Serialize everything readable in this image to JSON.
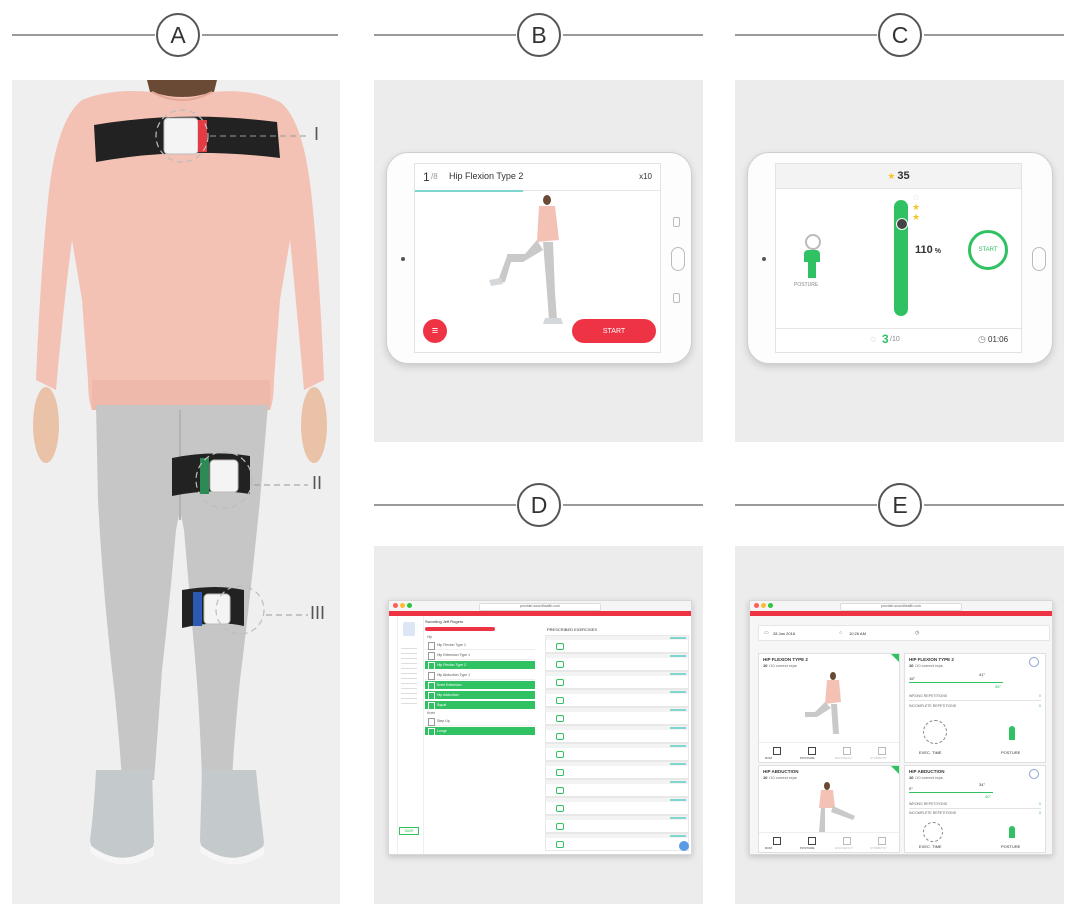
{
  "headers": {
    "a": "A",
    "b": "B",
    "c": "C",
    "d": "D",
    "e": "E"
  },
  "callouts": {
    "i": "I",
    "ii": "II",
    "iii": "III"
  },
  "panel_b": {
    "step_current": "1",
    "step_total": "/8",
    "exercise": "Hip Flexion Type 2",
    "reps": "x10",
    "start": "START"
  },
  "panel_c": {
    "stars": "35",
    "percent": "110",
    "percent_unit": "%",
    "posture": "POSTURE",
    "start": "START",
    "reps_done": "3",
    "reps_total": "/10",
    "timer": "01:06"
  },
  "panel_d": {
    "url": "provider.swordhealth.com",
    "patient_name": "Swording Jeff Rogers",
    "col_header": "PRESCRIBED EXERCISES",
    "list_items": [
      "Hip Flexion Type 1",
      "Hip Extension Type 1",
      "Hip Flexion Type 2",
      "Hip Abduction Type 1",
      "Knee Extension",
      "Hip Adduction",
      "Squat",
      "Step Up",
      "Lunge"
    ],
    "list_active": [
      false,
      false,
      true,
      false,
      true,
      true,
      true,
      false,
      true
    ],
    "section_labels": [
      "Hip",
      "Knee"
    ],
    "green_button": "SAVE"
  },
  "panel_e": {
    "url": "provider.swordhealth.com",
    "session_date": "28 Jan 2018",
    "session_time": "10:26 AM",
    "card1_title": "HIP FLEXION TYPE 2",
    "card1_sub_value": "10",
    "card1_sub_text": "/10 correct reps",
    "card1_angle_min": "16°",
    "card1_angle_max": "41°",
    "card1_angle_green": "38°",
    "card2_title": "HIP ABDUCTION",
    "card2_sub_value": "10",
    "card2_sub_text": "/10 correct reps",
    "card2_angle_min": "0°",
    "card2_angle_max": "34°",
    "card2_angle_green": "40°",
    "wrong_reps": "WRONG REPETITIONS",
    "incomplete_reps": "INCOMPLETE REPETITIONS",
    "zero": "0",
    "exec_time": "EXEC. TIME",
    "posture": "POSTURE",
    "tab_icons": [
      "ROM",
      "POSTURE",
      "EFFICIENCY",
      "SYMMETRY"
    ]
  },
  "colors": {
    "red": "#ee3344",
    "green": "#2fc162",
    "teal": "#7fd6d0",
    "panel_bg": "#ececec",
    "pink": "#f3c2b5"
  }
}
